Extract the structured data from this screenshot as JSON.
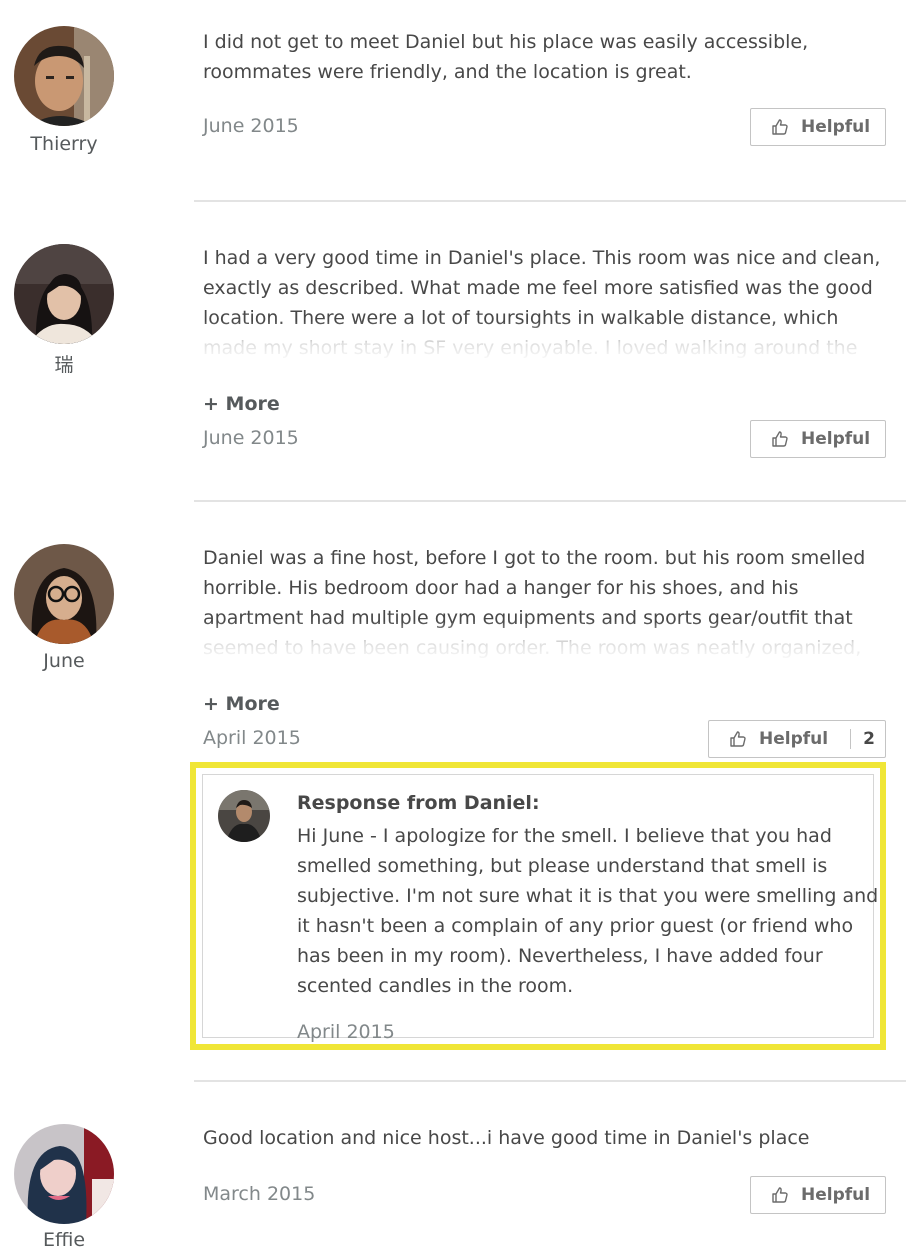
{
  "reviews": [
    {
      "reviewer": "Thierry",
      "text": "I did not get to meet Daniel but his place was easily accessible, roommates were friendly, and the location is great.",
      "date": "June 2015",
      "helpful_label": "Helpful"
    },
    {
      "reviewer": "瑞",
      "text": "I had a very good time in Daniel's place. This room was nice and clean, exactly as described. What made me feel more satisfied was the good location. There were a lot of toursights in walkable distance, which made my short stay in SF very enjoyable. I loved walking around the neighborhood and enjoyed the beautiful view. Just one block away up",
      "more_label": "+ More",
      "date": "June 2015",
      "helpful_label": "Helpful"
    },
    {
      "reviewer": "June",
      "text": "Daniel was a fine host, before I got to the room. but his room smelled horrible. His bedroom door had a hanger for his shoes, and his apartment had multiple gym equipments and sports gear/outfit that seemed to have been causing order. The room was neatly organized, but his room's odor was not for me. I left within half an hour since my nausea",
      "more_label": "+ More",
      "date": "April 2015",
      "helpful_label": "Helpful",
      "helpful_count": "2",
      "response": {
        "title": "Response from Daniel:",
        "text": "Hi June - I apologize for the smell. I believe that you had smelled something, but please understand that smell is subjective. I'm not sure what it is that you were smelling and it hasn't been a complain of any prior guest (or friend who has been in my room). Nevertheless, I have added four scented candles in the room.",
        "date": "April 2015"
      }
    },
    {
      "reviewer": "Effie",
      "text": "Good location and nice host...i have good time in Daniel's place",
      "date": "March 2015",
      "helpful_label": "Helpful"
    }
  ],
  "colors": {
    "highlight": "#f0e636",
    "divider": "#e3e3e3",
    "text": "#484848",
    "muted": "#82888a"
  },
  "icons": {
    "helpful": "thumbs-up-icon"
  }
}
